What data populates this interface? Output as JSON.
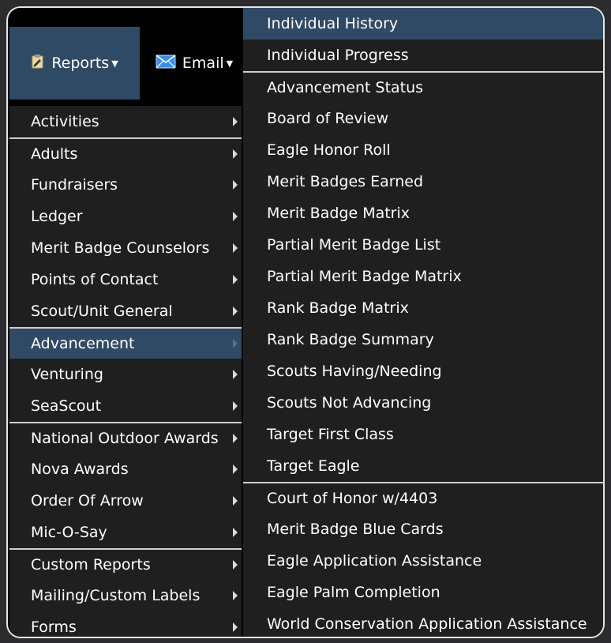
{
  "nav": {
    "reports_label": "Reports",
    "email_label": "Email"
  },
  "left_menu": [
    {
      "label": "Activities",
      "sep": false,
      "active": false
    },
    {
      "label": "Adults",
      "sep": true,
      "active": false
    },
    {
      "label": "Fundraisers",
      "sep": false,
      "active": false
    },
    {
      "label": "Ledger",
      "sep": false,
      "active": false
    },
    {
      "label": "Merit Badge Counselors",
      "sep": false,
      "active": false
    },
    {
      "label": "Points of Contact",
      "sep": false,
      "active": false
    },
    {
      "label": "Scout/Unit General",
      "sep": false,
      "active": false
    },
    {
      "label": "Advancement",
      "sep": true,
      "active": true
    },
    {
      "label": "Venturing",
      "sep": false,
      "active": false
    },
    {
      "label": "SeaScout",
      "sep": false,
      "active": false
    },
    {
      "label": "National Outdoor Awards",
      "sep": true,
      "active": false
    },
    {
      "label": "Nova Awards",
      "sep": false,
      "active": false
    },
    {
      "label": "Order Of Arrow",
      "sep": false,
      "active": false
    },
    {
      "label": "Mic-O-Say",
      "sep": false,
      "active": false
    },
    {
      "label": "Custom Reports",
      "sep": true,
      "active": false
    },
    {
      "label": "Mailing/Custom Labels",
      "sep": false,
      "active": false
    },
    {
      "label": "Forms",
      "sep": false,
      "active": false
    }
  ],
  "sub_menu": [
    {
      "label": "Individual History",
      "sep": false,
      "active": true
    },
    {
      "label": "Individual Progress",
      "sep": false,
      "active": false
    },
    {
      "label": "Advancement Status",
      "sep": true,
      "active": false
    },
    {
      "label": "Board of Review",
      "sep": false,
      "active": false
    },
    {
      "label": "Eagle Honor Roll",
      "sep": false,
      "active": false
    },
    {
      "label": "Merit Badges Earned",
      "sep": false,
      "active": false
    },
    {
      "label": "Merit Badge Matrix",
      "sep": false,
      "active": false
    },
    {
      "label": "Partial Merit Badge List",
      "sep": false,
      "active": false
    },
    {
      "label": "Partial Merit Badge Matrix",
      "sep": false,
      "active": false
    },
    {
      "label": "Rank Badge Matrix",
      "sep": false,
      "active": false
    },
    {
      "label": "Rank Badge Summary",
      "sep": false,
      "active": false
    },
    {
      "label": "Scouts Having/Needing",
      "sep": false,
      "active": false
    },
    {
      "label": "Scouts Not Advancing",
      "sep": false,
      "active": false
    },
    {
      "label": "Target First Class",
      "sep": false,
      "active": false
    },
    {
      "label": "Target Eagle",
      "sep": false,
      "active": false
    },
    {
      "label": "Court of Honor w/4403",
      "sep": true,
      "active": false
    },
    {
      "label": "Merit Badge Blue Cards",
      "sep": false,
      "active": false
    },
    {
      "label": "Eagle Application Assistance",
      "sep": false,
      "active": false
    },
    {
      "label": "Eagle Palm Completion",
      "sep": false,
      "active": false
    },
    {
      "label": "World Conservation Application Assistance",
      "sep": false,
      "active": false
    }
  ],
  "colors": {
    "highlight": "#2f4a64",
    "menu_bg": "#1f1f1f",
    "separator": "#cfcfcf"
  }
}
